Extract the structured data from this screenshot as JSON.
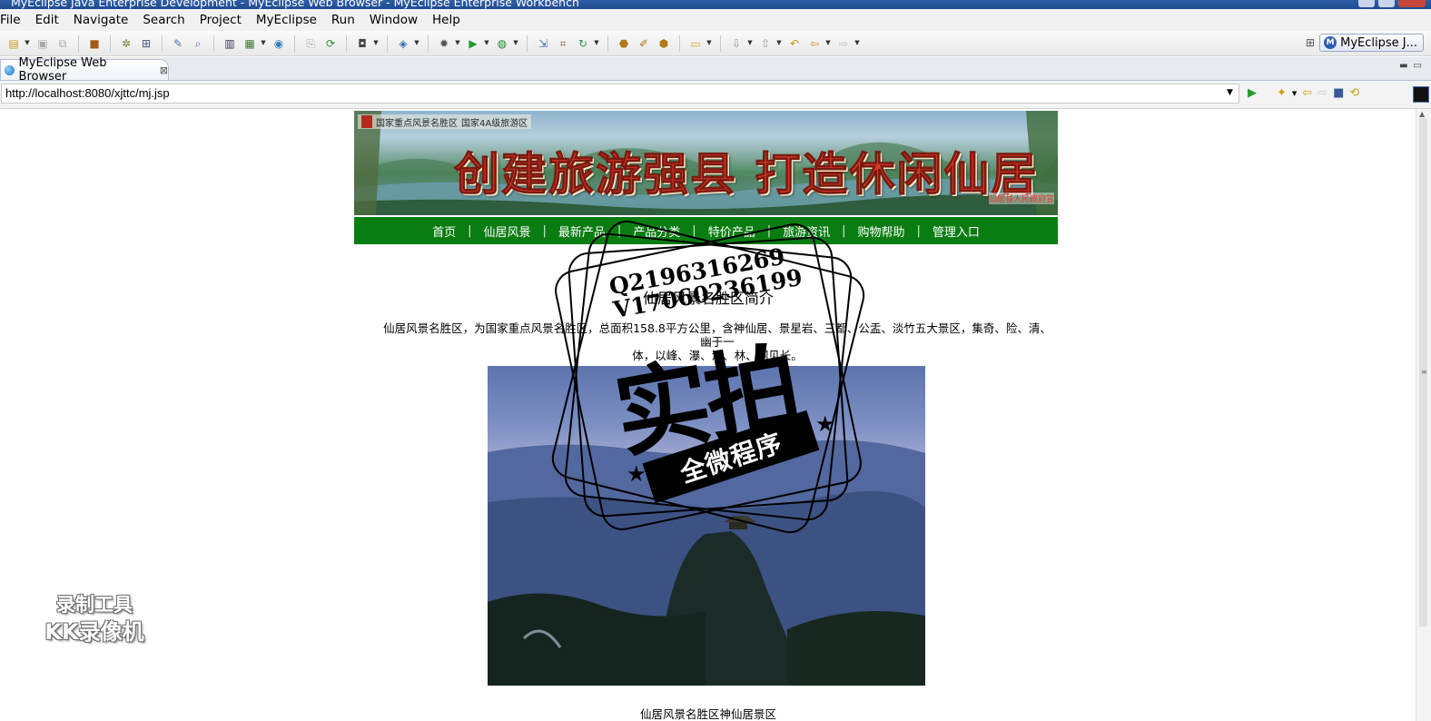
{
  "window": {
    "title": "MyEclipse Java Enterprise Development - MyEclipse Web Browser - MyEclipse Enterprise Workbench"
  },
  "menubar": [
    "File",
    "Edit",
    "Navigate",
    "Search",
    "Project",
    "MyEclipse",
    "Run",
    "Window",
    "Help"
  ],
  "toolbar": {
    "perspective_label": "MyEclipse J...",
    "icons": [
      "new-icon",
      "save-icon",
      "save-all-icon",
      "package-icon",
      "build-icon",
      "deploy-icon",
      "edit-icon",
      "browse-icon",
      "server-icon",
      "web-icon",
      "globe-icon",
      "open-icon",
      "refresh-icon",
      "camera-icon",
      "new-class-icon",
      "debug-icon",
      "run-icon",
      "external-tools-icon",
      "type-icon",
      "hierarchy-icon",
      "refresh-cycle-icon",
      "task-icon",
      "wrench-icon",
      "file-icon",
      "folder-icon",
      "next-annotation-icon",
      "previous-annotation-icon",
      "last-edit-icon",
      "back-icon",
      "forward-icon"
    ]
  },
  "editor_tab": {
    "label": "MyEclipse Web Browser"
  },
  "browser": {
    "url": "http://localhost:8080/xjttc/mj.jsp"
  },
  "page": {
    "banner": {
      "top_labels": [
        "国家重点风景名胜区",
        "国家4A级旅游区"
      ],
      "slogan": "创建旅游强县  打造休闲仙居",
      "sub_text": "仙居县人民政府宣"
    },
    "nav": [
      "首页",
      "仙居风景",
      "最新产品",
      "产品分类",
      "特价产品",
      "旅游资讯",
      "购物帮助",
      "管理入口"
    ],
    "title": "仙居风景名胜区简介",
    "paragraph_line1": "仙居风景名胜区，为国家重点风景名胜区，总面积158.8平方公里，含神仙居、景星岩、三都、公盂、淡竹五大景区，集奇、险、清、幽于一",
    "paragraph_line2": "体，以峰、瀑、溪、林、洞见长。",
    "caption": "仙居风景名胜区神仙居景区"
  },
  "overlay": {
    "stamp_contacts": [
      "Q2196316269",
      "V17060236199"
    ],
    "stamp_big": "实拍",
    "stamp_ribbon": "全微程序",
    "recorder_line1": "录制工具",
    "recorder_line2": "KK录像机"
  }
}
